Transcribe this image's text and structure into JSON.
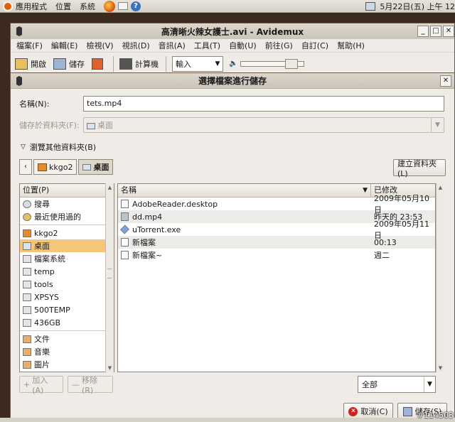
{
  "topbar": {
    "menus": [
      "應用程式",
      "位置",
      "系統"
    ],
    "clock": "5月22日(五) 上午 12"
  },
  "avidemux": {
    "title": "高清晰火辣女護士.avi - Avidemux",
    "menus": [
      "檔案(F)",
      "編輯(E)",
      "檢視(V)",
      "視訊(D)",
      "音訊(A)",
      "工具(T)",
      "自動(U)",
      "前往(G)",
      "自訂(C)",
      "幫助(H)"
    ],
    "toolbar": {
      "open": "開啟",
      "save": "儲存",
      "calculator": "計算機",
      "input_combo": "輸入"
    }
  },
  "dialog": {
    "title": "選擇檔案進行儲存",
    "name_label": "名稱(N):",
    "name_value": "tets.mp4",
    "save_in_label": "儲存於資料夾(F):",
    "save_in_value": "桌面",
    "browse_label": "瀏覽其他資料夾(B)",
    "path": [
      "kkgo2",
      "桌面"
    ],
    "create_folder": "建立資料夾(L)",
    "places_header": "位置(P)",
    "places": [
      "搜尋",
      "最近使用過的",
      "kkgo2",
      "桌面",
      "檔案系統",
      "temp",
      "tools",
      "XPSYS",
      "500TEMP",
      "436GB",
      "文件",
      "音樂",
      "圖片"
    ],
    "selected_place": "桌面",
    "columns": {
      "name": "名稱",
      "modified": "已修改"
    },
    "files": [
      {
        "name": "AdobeReader.desktop",
        "modified": "2009年05月10日",
        "icon": "document-icon"
      },
      {
        "name": "dd.mp4",
        "modified": "昨天的 23:53",
        "icon": "video-icon"
      },
      {
        "name": "uTorrent.exe",
        "modified": "2009年05月11日",
        "icon": "executable-icon"
      },
      {
        "name": "新檔案",
        "modified": "00:13",
        "icon": "document-icon"
      },
      {
        "name": "新檔案~",
        "modified": "週二",
        "icon": "document-icon"
      }
    ],
    "add_button": "加入(A)",
    "remove_button": "移除(R)",
    "filter_value": "全部",
    "cancel_button": "取消(C)",
    "save_button": "儲存(S)"
  },
  "watermark": "#114503"
}
